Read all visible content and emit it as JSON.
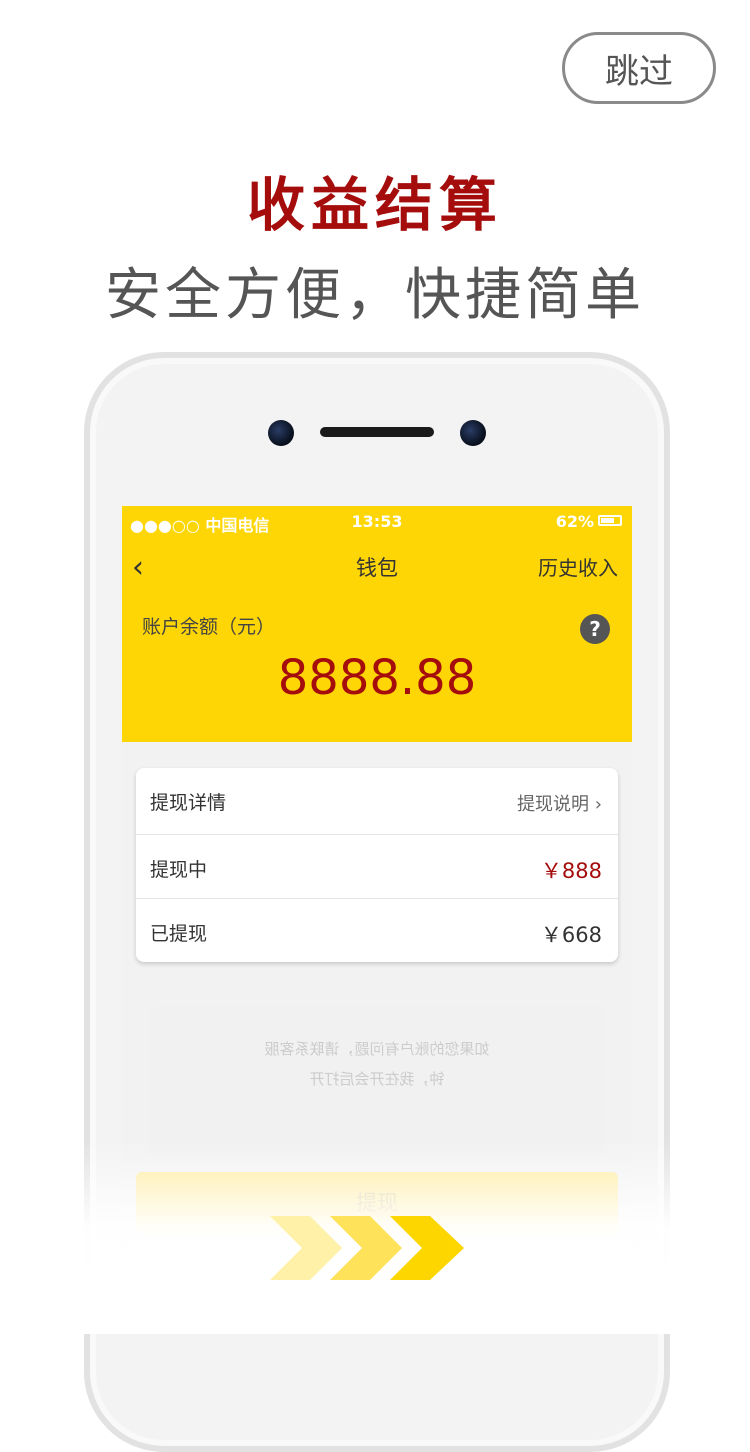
{
  "skip_label": "跳过",
  "headline": "收益结算",
  "subline": "安全方便，快捷简单",
  "colors": {
    "accent": "#a50d0d",
    "header_yellow": "#fed605"
  },
  "status_bar": {
    "carrier": "●●●○○ 中国电信",
    "time": "13:53",
    "battery": "62%"
  },
  "wallet": {
    "back_icon": "chevron-left-icon",
    "title": "钱包",
    "history_label": "历史收入",
    "balance_label": "账户余额（元）",
    "help_icon": "question-icon",
    "balance": "8888.88"
  },
  "details": {
    "title": "提现详情",
    "explain_link": "提现说明",
    "rows": [
      {
        "label": "提现中",
        "value": "￥888"
      },
      {
        "label": "已提现",
        "value": "￥668"
      }
    ]
  },
  "faded_notes": [
    "如果您的账户有问题，请联系客服",
    "钟，我在开会后打开"
  ],
  "withdraw_label": "提现"
}
